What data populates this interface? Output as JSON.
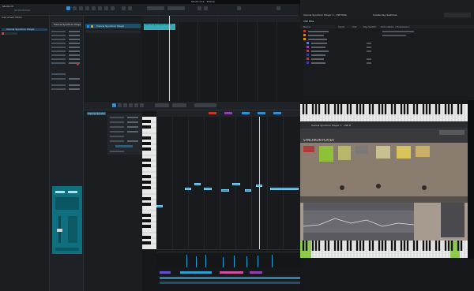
{
  "window": {
    "title": "Studio One - Potpop",
    "app_label": "Studio One"
  },
  "toolbar": {
    "time_display": "00:00:00.000"
  },
  "left_panel": {
    "header": "Instrument Editor",
    "track_name": "Vienna Synchron Player"
  },
  "inspector": {
    "header": "Vienna Synchron Player"
  },
  "arrange": {
    "region_label": "Vienna Synchron Player"
  },
  "piano_roll": {
    "instrument": "Vienna Synchron Player"
  },
  "right_panel": {
    "title": "Vienna Synchron Player 1 - VSE Elite",
    "subtitle": "Create Key Switches",
    "tab": "VSE Elite",
    "columns": [
      "Name",
      "Input",
      "Inst",
      "Key Switch",
      "Articulation / Expression"
    ]
  },
  "plugin": {
    "name": "SYNCHRON PLAYER"
  },
  "colors": {
    "accent": "#2f8fd0",
    "note": "#2a9ed1",
    "mixer": "#0f6f7f"
  }
}
